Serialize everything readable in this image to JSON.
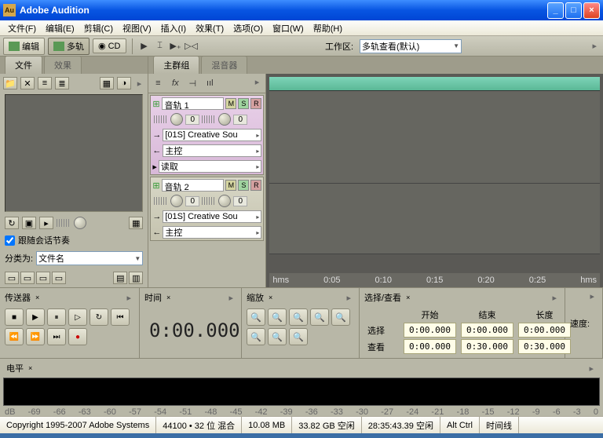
{
  "titlebar": {
    "app_icon": "Au",
    "title": "Adobe Audition"
  },
  "menus": [
    "文件(F)",
    "编辑(E)",
    "剪辑(C)",
    "视图(V)",
    "插入(I)",
    "效果(T)",
    "选项(O)",
    "窗口(W)",
    "帮助(H)"
  ],
  "modes": {
    "edit": "编辑",
    "multitrack": "多轨",
    "cd": "CD"
  },
  "workspace": {
    "label": "工作区:",
    "value": "多轨查看(默认)"
  },
  "left_panel": {
    "tab_file": "文件",
    "tab_effects": "效果",
    "follow_tempo": "跟随会话节奏",
    "sort_label": "分类为:",
    "sort_value": "文件名"
  },
  "center": {
    "tab_main": "主群组",
    "tab_mixer": "混音器",
    "tracks": [
      {
        "name": "音轨 1",
        "vol": "0",
        "pan": "0",
        "input": "[01S] Creative Sou",
        "output": "主控",
        "read": "读取",
        "selected": true
      },
      {
        "name": "音轨 2",
        "vol": "0",
        "pan": "0",
        "input": "[01S] Creative Sou",
        "output": "主控",
        "selected": false
      }
    ],
    "ruler": {
      "unit_left": "hms",
      "ticks": [
        "0:05",
        "0:10",
        "0:15",
        "0:20",
        "0:25"
      ],
      "unit_right": "hms"
    }
  },
  "transport": {
    "title": "传送器"
  },
  "time_panel": {
    "title": "时间",
    "value": "0:00.000"
  },
  "zoom_panel": {
    "title": "缩放"
  },
  "selview": {
    "title": "选择/查看",
    "hdr_start": "开始",
    "hdr_end": "结束",
    "hdr_len": "长度",
    "row_sel": "选择",
    "row_view": "查看",
    "sel": [
      "0:00.000",
      "0:00.000",
      "0:00.000"
    ],
    "view": [
      "0:00.000",
      "0:30.000",
      "0:30.000"
    ]
  },
  "speed": {
    "label": "速度:"
  },
  "level": {
    "title": "电平",
    "scale": [
      "dB",
      "-69",
      "-66",
      "-63",
      "-60",
      "-57",
      "-54",
      "-51",
      "-48",
      "-45",
      "-42",
      "-39",
      "-36",
      "-33",
      "-30",
      "-27",
      "-24",
      "-21",
      "-18",
      "-15",
      "-12",
      "-9",
      "-6",
      "-3",
      "0"
    ]
  },
  "status": {
    "copyright": "Copyright 1995-2007 Adobe Systems",
    "sample": "44100 • 32 位 混合",
    "size": "10.08 MB",
    "disk": "33.82 GB 空闲",
    "time": "28:35:43.39 空闲",
    "mods": "Alt Ctrl",
    "timeline": "时间线"
  }
}
